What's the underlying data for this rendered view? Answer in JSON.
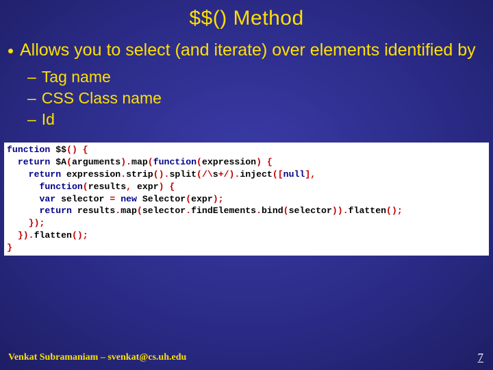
{
  "title": "$$() Method",
  "bullet": "Allows you to select (and iterate) over elements identified by",
  "sub": {
    "a": "Tag name",
    "b": "CSS Class name",
    "c": "Id"
  },
  "code": {
    "l1a": "function",
    "l1b": " $$",
    "l1c": "() {",
    "l2a": "  return",
    "l2b": " $A",
    "l2c": "(",
    "l2d": "arguments",
    "l2e": ").",
    "l2f": "map",
    "l2g": "(",
    "l2h": "function",
    "l2i": "(",
    "l2j": "expression",
    "l2k": ") {",
    "l3a": "    return",
    "l3b": " expression",
    "l3c": ".",
    "l3d": "strip",
    "l3e": "().",
    "l3f": "split",
    "l3g": "(/\\",
    "l3h": "s",
    "l3i": "+/).",
    "l3j": "inject",
    "l3k": "([",
    "l3l": "null",
    "l3m": "],",
    "l4a": "      function",
    "l4b": "(",
    "l4c": "results",
    "l4d": ", ",
    "l4e": "expr",
    "l4f": ") {",
    "l5a": "      var",
    "l5b": " selector ",
    "l5c": "= ",
    "l5d": "new",
    "l5e": " Selector",
    "l5f": "(",
    "l5g": "expr",
    "l5h": ");",
    "l6a": "      return",
    "l6b": " results",
    "l6c": ".",
    "l6d": "map",
    "l6e": "(",
    "l6f": "selector",
    "l6g": ".",
    "l6h": "findElements",
    "l6i": ".",
    "l6j": "bind",
    "l6k": "(",
    "l6l": "selector",
    "l6m": ")).",
    "l6n": "flatten",
    "l6o": "();",
    "l7": "    });",
    "l8a": "  }).",
    "l8b": "flatten",
    "l8c": "();",
    "l9": "}"
  },
  "footer": "Venkat Subramaniam – svenkat@cs.uh.edu",
  "page": "7"
}
